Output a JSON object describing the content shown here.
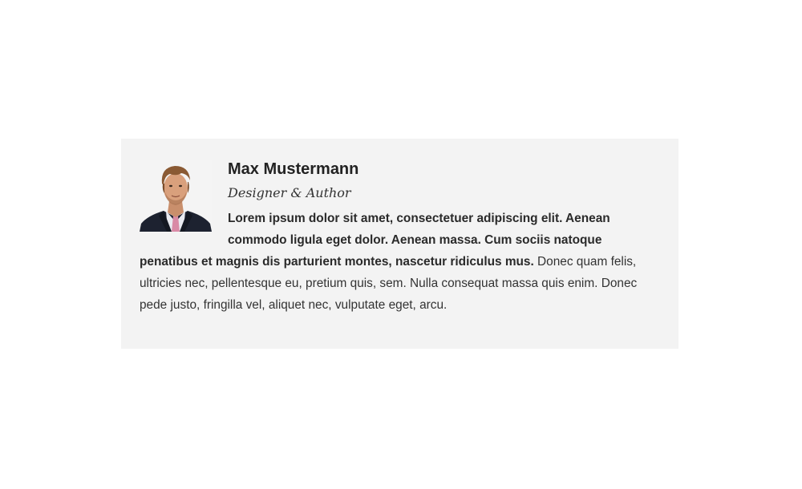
{
  "author": {
    "name": "Max Mustermann",
    "role": "Designer & Author",
    "bio_bold": "Lorem ipsum dolor sit amet, consectetuer adipiscing elit. Aenean commodo ligula eget dolor. Aenean massa. Cum sociis natoque penatibus et magnis dis parturient montes, nascetur ridiculus mus.",
    "bio_regular": " Donec quam felis, ultricies nec, pellentesque eu, pretium quis, sem. Nulla consequat massa quis enim. Donec pede justo, fringilla vel, aliquet nec, vulputate eget, arcu."
  },
  "colors": {
    "box_background": "#f3f3f3",
    "text": "#333333",
    "heading": "#222222"
  }
}
